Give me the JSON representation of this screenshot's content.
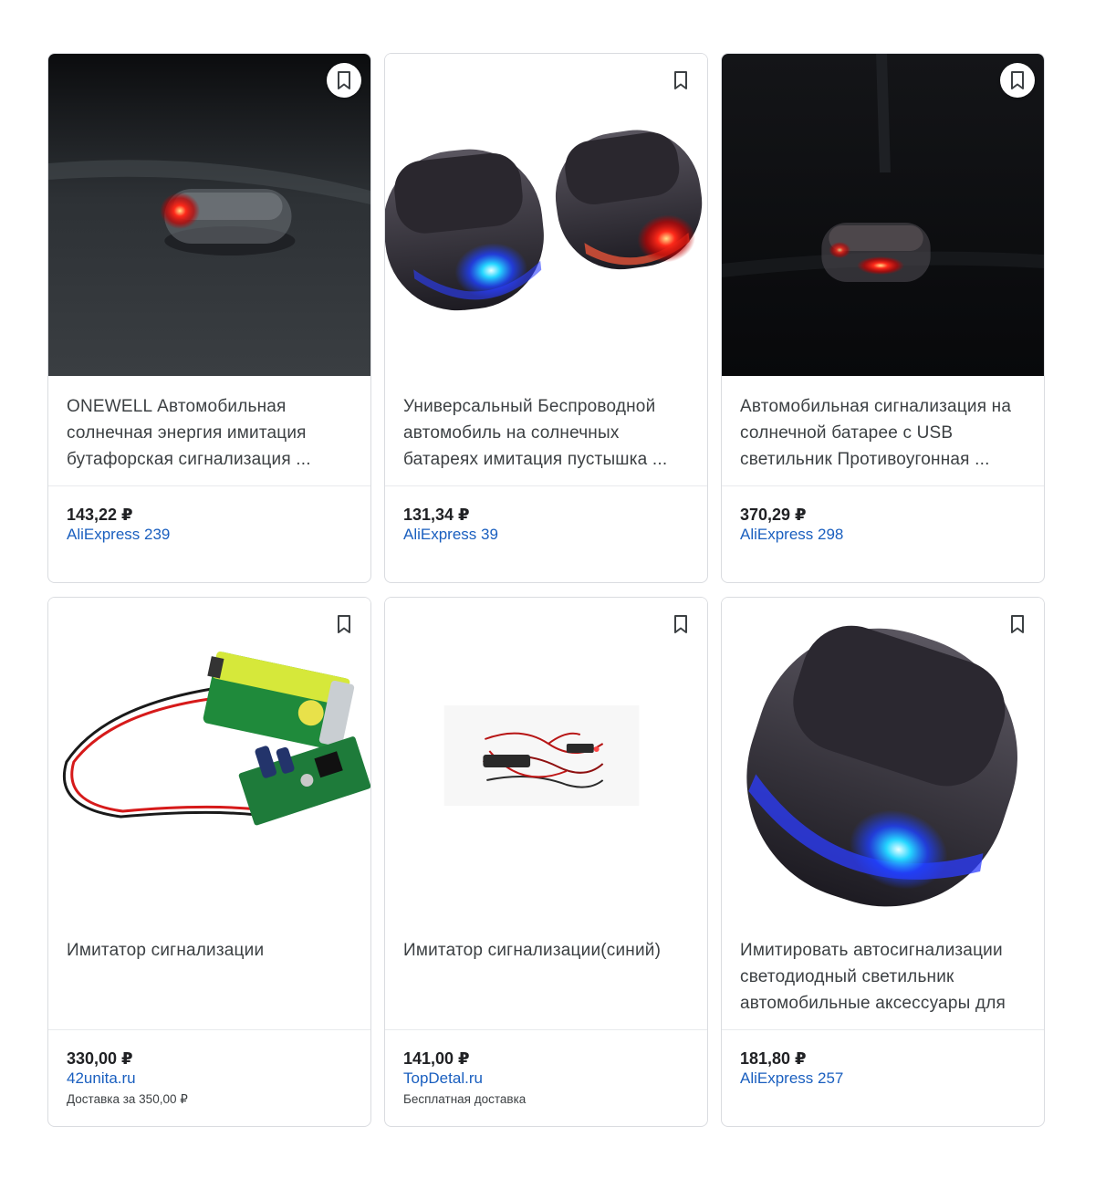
{
  "products": [
    {
      "title": "ONEWELL Автомобильная солнечная энергия имитация бутафорская сигнализация ...",
      "price": "143,22 ₽",
      "seller": "AliExpress 239",
      "shipping": "",
      "image": "dark-car-dashboard-red-led-emitter",
      "bookmark_style": "filled-circle"
    },
    {
      "title": "Универсальный Беспроводной автомобиль на солнечных батареях имитация пустышка ...",
      "price": "131,34 ₽",
      "seller": "AliExpress 39",
      "shipping": "",
      "image": "two-solar-alarm-pods-blue-red",
      "bookmark_style": "outline"
    },
    {
      "title": "Автомобильная сигнализация на солнечной батарее с USB светильник Противоугонная ...",
      "price": "370,29 ₽",
      "seller": "AliExpress 298",
      "shipping": "",
      "image": "dark-scene-red-led-dome",
      "bookmark_style": "filled-circle"
    },
    {
      "title": "Имитатор сигнализации",
      "price": "330,00 ₽",
      "seller": "42unita.ru",
      "shipping": "Доставка за 350,00 ₽",
      "image": "9v-battery-with-circuit-board",
      "bookmark_style": "outline"
    },
    {
      "title": "Имитатор сигнализации(синий)",
      "price": "141,00 ₽",
      "seller": "TopDetal.ru",
      "shipping": "Бесплатная доставка",
      "image": "cigarette-lighter-plug-cable",
      "bookmark_style": "outline"
    },
    {
      "title": "Имитировать автосигнализации светодиодный светильник автомобильные аксессуары для",
      "price": "181,80 ₽",
      "seller": "AliExpress 257",
      "shipping": "",
      "image": "solar-alarm-pod-blue-led",
      "bookmark_style": "outline"
    }
  ],
  "icons": {
    "bookmark": "bookmark-icon"
  },
  "colors": {
    "seller_link": "#1a5fbf",
    "price_text": "#202124",
    "title_text": "#3c4043",
    "border": "#dadce0"
  }
}
